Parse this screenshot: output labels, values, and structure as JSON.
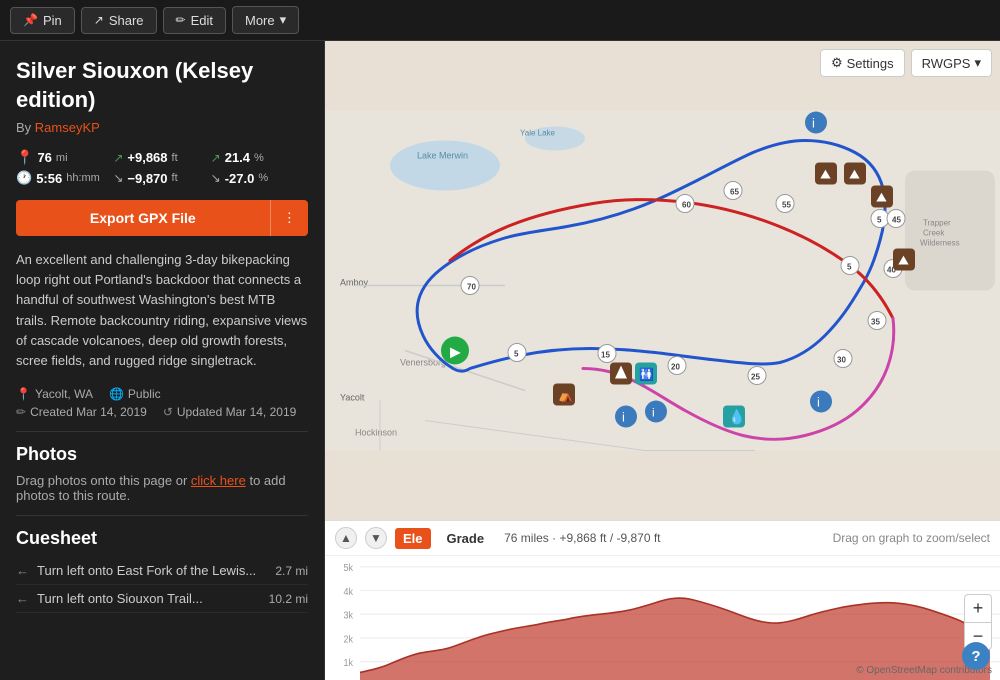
{
  "topbar": {
    "pin_label": "Pin",
    "share_label": "Share",
    "edit_label": "Edit",
    "more_label": "More"
  },
  "route": {
    "title": "Silver Siouxon (Kelsey edition)",
    "author_prefix": "By",
    "author_name": "RamseyKP",
    "stats": {
      "distance": "76",
      "distance_unit": "mi",
      "elevation_gain": "+9,868",
      "elevation_gain_unit": "ft",
      "elevation_gain_pct": "21.4",
      "time": "5:56",
      "time_unit": "hh:mm",
      "elevation_loss": "−9,870",
      "elevation_loss_unit": "ft",
      "elevation_loss_pct": "-27.0"
    },
    "export_btn_label": "Export GPX File",
    "description": "An excellent and challenging 3-day bikepacking loop right out Portland's backdoor that connects a handful of southwest Washington's best MTB trails. Remote backcountry riding, expansive views of cascade volcanoes, deep old growth forests, scree fields, and rugged ridge singletrack.",
    "location": "Yacolt, WA",
    "visibility": "Public",
    "created": "Created Mar 14, 2019",
    "updated": "Updated Mar 14, 2019"
  },
  "photos": {
    "section_title": "Photos",
    "help_text": "Drag photos onto this page or",
    "link_text": "click here",
    "help_text2": "to add photos to this route."
  },
  "cuesheet": {
    "section_title": "Cuesheet",
    "items": [
      {
        "direction": "←",
        "text": "Turn left onto East Fork of the Lewis...",
        "distance": "2.7 mi"
      },
      {
        "direction": "←",
        "text": "Turn left onto Siouxon Trail...",
        "distance": "10.2 mi"
      }
    ]
  },
  "map": {
    "settings_label": "Settings",
    "rwgps_label": "RWGPS"
  },
  "elevation": {
    "ele_tab": "Ele",
    "grade_tab": "Grade",
    "stats_text": "76 miles · +9,868 ft / -9,870 ft",
    "hint_text": "Drag on graph to zoom/select"
  },
  "zoom": {
    "plus": "+",
    "minus": "−"
  },
  "osm_credit": "© OpenStreetMap contributors",
  "help_icon": "?",
  "chart": {
    "y_labels": [
      "5k",
      "4k",
      "3k",
      "2k",
      "1k"
    ],
    "y_values": [
      5000,
      4000,
      3000,
      2000,
      1000
    ]
  }
}
